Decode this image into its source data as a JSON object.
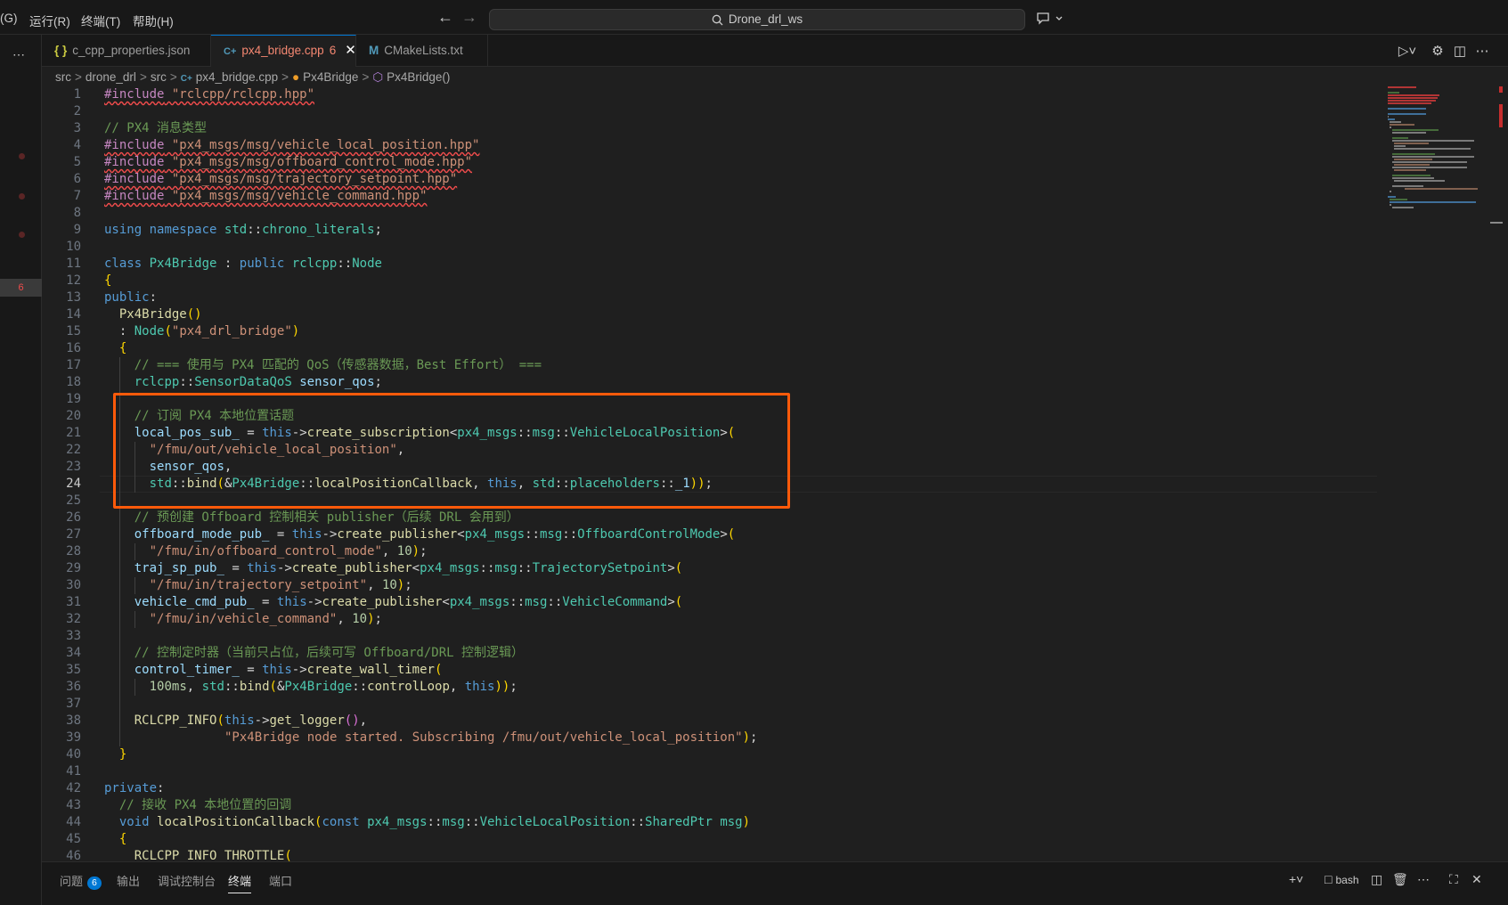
{
  "menu": [
    "(G)",
    "运行(R)",
    "终端(T)",
    "帮助(H)"
  ],
  "search": {
    "text": "Drone_drl_ws"
  },
  "tabs": [
    {
      "icon": "{ }",
      "label": "c_cpp_properties.json",
      "active": false
    },
    {
      "icon": "C+",
      "label": "px4_bridge.cpp",
      "count": "6",
      "active": true
    },
    {
      "icon": "M",
      "label": "CMakeLists.txt",
      "active": false
    }
  ],
  "breadcrumbs": [
    "src",
    "drone_drl",
    "src",
    "px4_bridge.cpp",
    "Px4Bridge",
    "Px4Bridge()"
  ],
  "activity": {
    "error_count": "6"
  },
  "editor": {
    "current_line": 24,
    "lines": [
      "#include \"rclcpp/rclcpp.hpp\"",
      "",
      "// PX4 消息类型",
      "#include \"px4_msgs/msg/vehicle_local_position.hpp\"",
      "#include \"px4_msgs/msg/offboard_control_mode.hpp\"",
      "#include \"px4_msgs/msg/trajectory_setpoint.hpp\"",
      "#include \"px4_msgs/msg/vehicle_command.hpp\"",
      "",
      "using namespace std::chrono_literals;",
      "",
      "class Px4Bridge : public rclcpp::Node",
      "{",
      "public:",
      "  Px4Bridge()",
      "  : Node(\"px4_drl_bridge\")",
      "  {",
      "    // === 使用与 PX4 匹配的 QoS（传感器数据，Best Effort） ===",
      "    rclcpp::SensorDataQoS sensor_qos;",
      "",
      "    // 订阅 PX4 本地位置话题",
      "    local_pos_sub_ = this->create_subscription<px4_msgs::msg::VehicleLocalPosition>(",
      "      \"/fmu/out/vehicle_local_position\",",
      "      sensor_qos,",
      "      std::bind(&Px4Bridge::localPositionCallback, this, std::placeholders::_1));",
      "",
      "    // 预创建 Offboard 控制相关 publisher（后续 DRL 会用到）",
      "    offboard_mode_pub_ = this->create_publisher<px4_msgs::msg::OffboardControlMode>(",
      "      \"/fmu/in/offboard_control_mode\", 10);",
      "    traj_sp_pub_ = this->create_publisher<px4_msgs::msg::TrajectorySetpoint>(",
      "      \"/fmu/in/trajectory_setpoint\", 10);",
      "    vehicle_cmd_pub_ = this->create_publisher<px4_msgs::msg::VehicleCommand>(",
      "      \"/fmu/in/vehicle_command\", 10);",
      "",
      "    // 控制定时器（当前只占位，后续可写 Offboard/DRL 控制逻辑）",
      "    control_timer_ = this->create_wall_timer(",
      "      100ms, std::bind(&Px4Bridge::controlLoop, this));",
      "",
      "    RCLCPP_INFO(this->get_logger(),",
      "                \"Px4Bridge node started. Subscribing /fmu/out/vehicle_local_position\");",
      "  }",
      "",
      "private:",
      "  // 接收 PX4 本地位置的回调",
      "  void localPositionCallback(const px4_msgs::msg::VehicleLocalPosition::SharedPtr msg)",
      "  {",
      "    RCLCPP_INFO_THROTTLE("
    ]
  },
  "panel": {
    "tabs": [
      {
        "label": "问题",
        "badge": "6"
      },
      {
        "label": "输出"
      },
      {
        "label": "调试控制台"
      },
      {
        "label": "终端",
        "active": true
      },
      {
        "label": "端口"
      }
    ],
    "terminal_name": "bash"
  },
  "colors": {
    "accent": "#0078d4",
    "annotation": "#ff5a0a",
    "error": "#f14c4c"
  }
}
